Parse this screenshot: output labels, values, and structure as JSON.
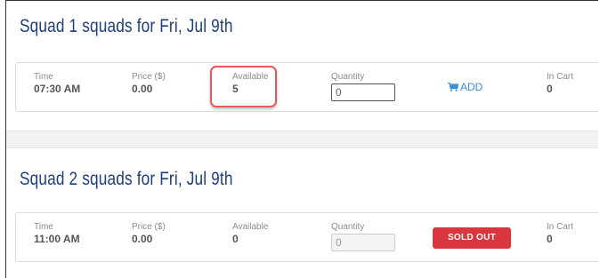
{
  "squads": [
    {
      "title": "Squad 1 squads for Fri, Jul 9th",
      "time_label": "Time",
      "time_value": "07:30 AM",
      "price_label": "Price ($)",
      "price_value": "0.00",
      "available_label": "Available",
      "available_value": "5",
      "quantity_label": "Quantity",
      "quantity_value": "0",
      "action_label": "ADD",
      "in_cart_label": "In Cart",
      "in_cart_value": "0"
    },
    {
      "title": "Squad 2 squads for Fri, Jul 9th",
      "time_label": "Time",
      "time_value": "11:00 AM",
      "price_label": "Price ($)",
      "price_value": "0.00",
      "available_label": "Available",
      "available_value": "0",
      "quantity_label": "Quantity",
      "quantity_value": "0",
      "action_label": "SOLD OUT",
      "in_cart_label": "In Cart",
      "in_cart_value": "0"
    }
  ],
  "colors": {
    "title": "#1f3f7a",
    "add_link": "#3c8fd0",
    "sold_out_bg": "#d9363e",
    "highlight": "#e35b5b"
  },
  "icons": {
    "add": "cart-icon"
  }
}
